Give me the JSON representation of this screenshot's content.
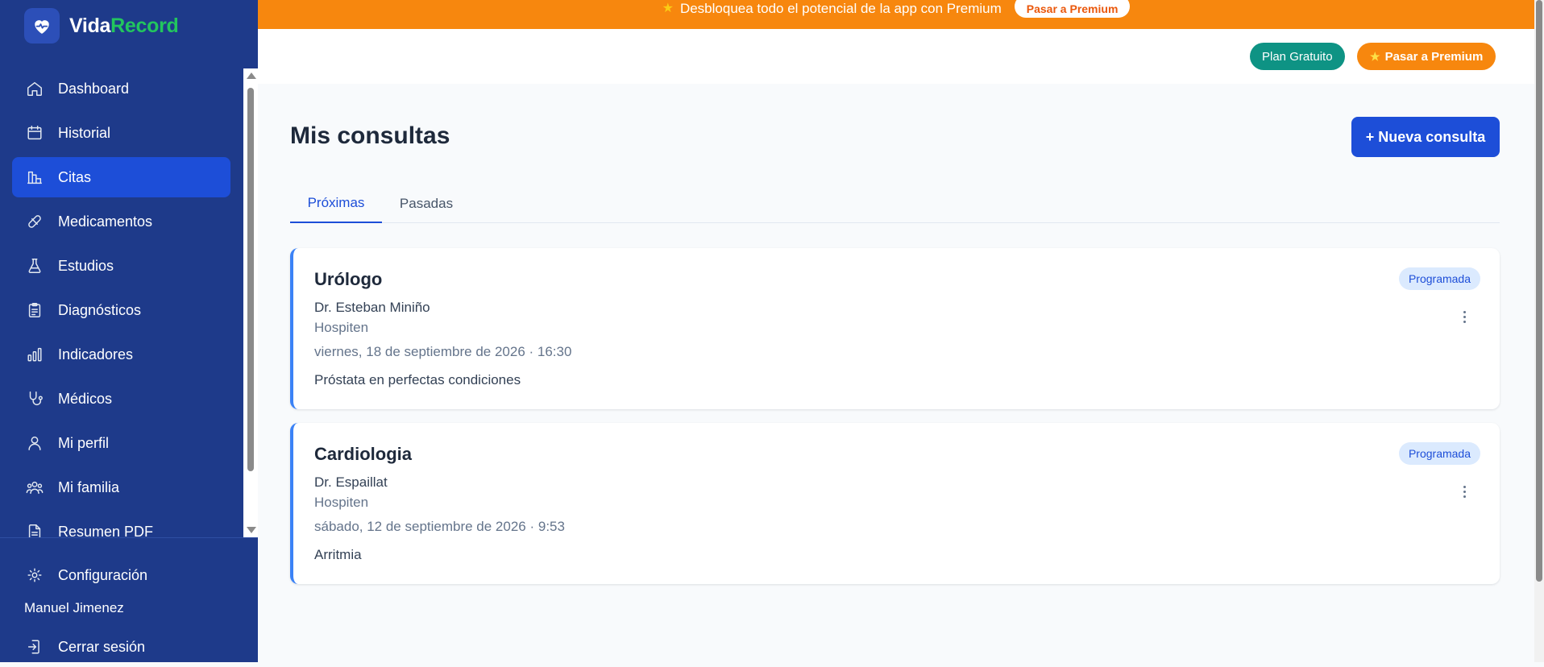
{
  "brand": {
    "name_part1": "Vida",
    "name_part2": "Record"
  },
  "sidebar": {
    "items": [
      {
        "label": "Dashboard",
        "icon": "home-icon"
      },
      {
        "label": "Historial",
        "icon": "calendar-icon"
      },
      {
        "label": "Citas",
        "icon": "appointments-icon",
        "active": true
      },
      {
        "label": "Medicamentos",
        "icon": "pill-icon"
      },
      {
        "label": "Estudios",
        "icon": "flask-icon"
      },
      {
        "label": "Diagnósticos",
        "icon": "clipboard-icon"
      },
      {
        "label": "Indicadores",
        "icon": "bar-chart-icon"
      },
      {
        "label": "Médicos",
        "icon": "stethoscope-icon"
      },
      {
        "label": "Mi perfil",
        "icon": "user-icon"
      },
      {
        "label": "Mi familia",
        "icon": "users-icon"
      },
      {
        "label": "Resumen PDF",
        "icon": "file-icon"
      }
    ],
    "settings_label": "Configuración",
    "user_name": "Manuel Jimenez",
    "logout_label": "Cerrar sesión"
  },
  "promo": {
    "text": "Desbloquea todo el potencial de la app con Premium",
    "button_label": "Pasar a Premium"
  },
  "topbar": {
    "plan_label": "Plan Gratuito",
    "premium_label": "Pasar a Premium"
  },
  "main": {
    "title": "Mis consultas",
    "new_button": "+ Nueva consulta",
    "tabs": [
      {
        "label": "Próximas",
        "active": true
      },
      {
        "label": "Pasadas",
        "active": false
      }
    ],
    "appointments": [
      {
        "specialty": "Urólogo",
        "doctor": "Dr. Esteban Miniño",
        "place": "Hospiten",
        "datetime": "viernes, 18 de septiembre de 2026 · 16:30",
        "note": "Próstata en perfectas condiciones",
        "status": "Programada"
      },
      {
        "specialty": "Cardiologia",
        "doctor": "Dr. Espaillat",
        "place": "Hospiten",
        "datetime": "sábado, 12 de septiembre de 2026 · 9:53",
        "note": "Arritmia",
        "status": "Programada"
      }
    ]
  },
  "colors": {
    "sidebar_bg": "#1e3a8a",
    "accent_blue": "#1d4ed8",
    "promo_orange": "#f7870e",
    "plan_teal": "#0e9384",
    "brand_green": "#22c55e"
  }
}
